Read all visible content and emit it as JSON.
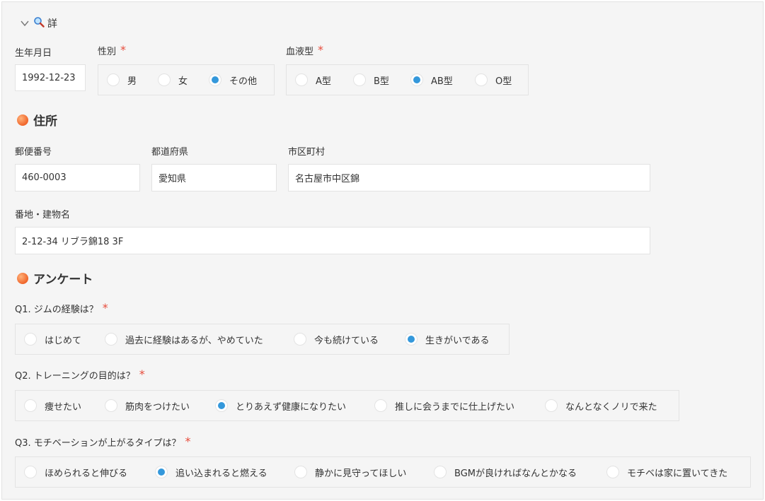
{
  "header": {
    "toggle_icon": "chevron-down-icon",
    "search_icon": "search-icon",
    "title": "詳"
  },
  "profile": {
    "birthdate": {
      "label": "生年月日",
      "value": "1992-12-23"
    },
    "gender": {
      "label": "性別",
      "required_mark": "*",
      "options": [
        "男",
        "女",
        "その他"
      ],
      "selected": "その他"
    },
    "blood": {
      "label": "血液型",
      "required_mark": "*",
      "options": [
        "A型",
        "B型",
        "AB型",
        "O型"
      ],
      "selected": "AB型"
    }
  },
  "address": {
    "section_title": "住所",
    "postal": {
      "label": "郵便番号",
      "value": "460-0003"
    },
    "prefecture": {
      "label": "都道府県",
      "value": "愛知県"
    },
    "city": {
      "label": "市区町村",
      "value": "名古屋市中区錦"
    },
    "street": {
      "label": "番地・建物名",
      "value": "2-12-34 リブラ錦18 3F"
    }
  },
  "survey": {
    "section_title": "アンケート",
    "q1": {
      "label": "Q1. ジムの経験は？",
      "required_mark": "*",
      "options": [
        "はじめて",
        "過去に経験はあるが、やめていた",
        "今も続けている",
        "生きがいである"
      ],
      "selected": "生きがいである"
    },
    "q2": {
      "label": "Q2. トレーニングの目的は？",
      "required_mark": "*",
      "options": [
        "痩せたい",
        "筋肉をつけたい",
        "とりあえず健康になりたい",
        "推しに会うまでに仕上げたい",
        "なんとなくノリで来た"
      ],
      "selected": "とりあえず健康になりたい"
    },
    "q3": {
      "label": "Q3. モチベーションが上がるタイプは？",
      "required_mark": "*",
      "options": [
        "ほめられると伸びる",
        "追い込まれると燃える",
        "静かに見守ってほしい",
        "BGMが良ければなんとかなる",
        "モチベは家に置いてきた"
      ],
      "selected": "追い込まれると燃える"
    }
  },
  "colors": {
    "accent": "#3498db",
    "required": "#e74c3c",
    "section_dot": "#f0652a",
    "panel_bg": "#f5f5f5",
    "border": "#e3e3e3"
  }
}
